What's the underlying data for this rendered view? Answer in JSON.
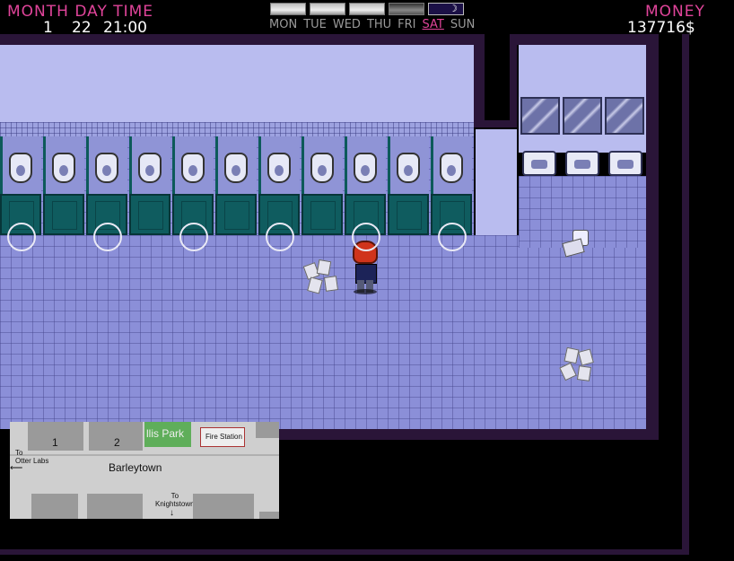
{
  "hud": {
    "date_label": "MONTH DAY TIME",
    "month": "1",
    "day": "22",
    "time": "21:00",
    "money_label": "MONEY",
    "money_value": "137716$"
  },
  "weekdays": {
    "mon": "MON",
    "tue": "TUE",
    "wed": "WED",
    "thu": "THU",
    "fri": "FRI",
    "sat": "SAT",
    "sun": "SUN",
    "active": "SAT"
  },
  "colors": {
    "hud_label": "#e0449a",
    "floor": "#8b8fd8",
    "stall_door": "#0f5c5f",
    "wall_trim": "#2a1538"
  },
  "minimap": {
    "block_1": "1",
    "block_2": "2",
    "park": "llis Park",
    "fire_station": "Fire Station",
    "to_otter_labs": "To\nOtter Labs",
    "town": "Barleytown",
    "to_knightstown": "To\nKnightstown"
  }
}
